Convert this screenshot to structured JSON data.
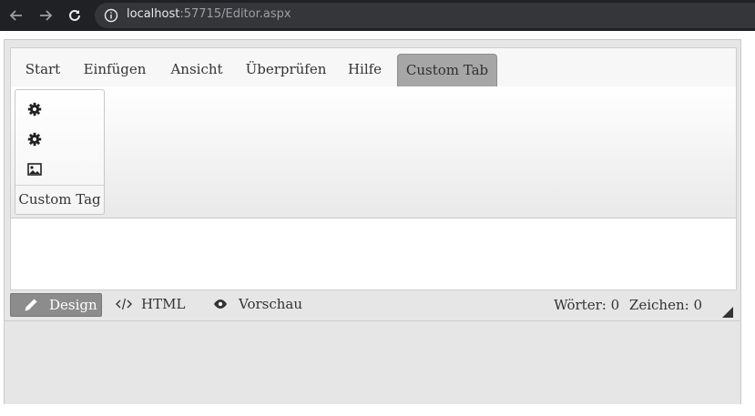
{
  "browser": {
    "url_host": "localhost",
    "url_rest": ":57715/Editor.aspx"
  },
  "tabs": [
    {
      "label": "Start"
    },
    {
      "label": "Einfügen"
    },
    {
      "label": "Ansicht"
    },
    {
      "label": "Überprüfen"
    },
    {
      "label": "Hilfe"
    },
    {
      "label": "Custom Tab"
    }
  ],
  "ribbon": {
    "group": {
      "label": "Custom Tag",
      "buttons": [
        {
          "icon": "gear-icon"
        },
        {
          "icon": "gear-icon"
        },
        {
          "icon": "image-icon"
        }
      ]
    }
  },
  "modes": [
    {
      "label": "Design",
      "icon": "pencil-icon",
      "active": true
    },
    {
      "label": "HTML",
      "icon": "code-icon",
      "active": false
    },
    {
      "label": "Vorschau",
      "icon": "eye-icon",
      "active": false
    }
  ],
  "stats": {
    "words_label": "Wörter:",
    "words": "0",
    "chars_label": "Zeichen:",
    "chars": "0"
  },
  "colors": {
    "chrome_bg": "#202124",
    "active_tab_bg": "#a6a6a6",
    "active_mode_bg": "#8c8c8c",
    "editor_bg": "#e6e6e6"
  }
}
